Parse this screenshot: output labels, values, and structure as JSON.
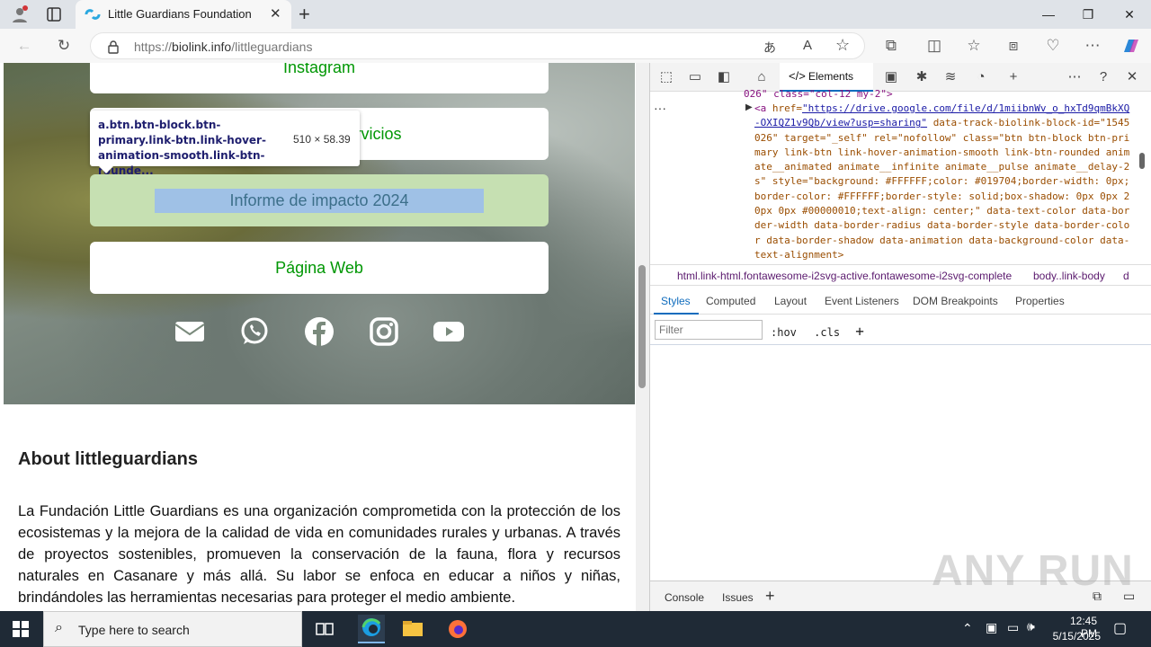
{
  "browser": {
    "tab_title": "Little Guardians Foundation",
    "url_prefix": "https://",
    "url_host": "biolink.info",
    "url_path": "/littleguardians"
  },
  "page": {
    "links": [
      {
        "label": "Instagram"
      },
      {
        "label": "Servicios"
      },
      {
        "label": "Informe de impacto 2024"
      },
      {
        "label": "Página Web"
      }
    ],
    "social_icons": [
      "envelope-icon",
      "whatsapp-icon",
      "facebook-icon",
      "instagram-icon",
      "youtube-icon"
    ],
    "tooltip": {
      "selector": "a.btn.btn-block.btn-primary.link-btn.link-hover-animation-smooth.link-btn-rounde...",
      "dimensions": "510 × 58.39"
    },
    "about_heading": "About littleguardians",
    "about_text": "La Fundación Little Guardians es una organización comprometida con la protección de los ecosistemas y la mejora de la calidad de vida en comunidades rurales y urbanas. A través de proyectos sostenibles, promueven la conservación de la fauna, flora y recursos naturales en Casanare y más allá. Su labor se enfoca en educar a niños y niñas, brindándoles las herramientas necesarias para proteger el medio ambiente.",
    "link_color": "#019704"
  },
  "devtools": {
    "active_tab": "Elements",
    "code_head": "026\" class=\"col-12 my-2\">",
    "code_body_tag": "<a",
    "code_href_attr": "href=",
    "code_href": "\"https://drive.google.com/file/d/1miibnWv_o_hxTd9qmBkXQ-OXIQZ1v9Qb/view?usp=sharing\"",
    "code_rest": "data-track-biolink-block-id=\"1545026\" target=\"_self\" rel=\"nofollow\" class=\"btn btn-block btn-primary link-btn link-hover-animation-smooth link-btn-rounded  animate__animated animate__infinite animate__pulse animate__delay-2s\" style=\"background: #FFFFFF;color: #019704;border-width: 0px;border-color: #FFFFFF;border-style: solid;box-shadow: 0px 0px 20px 0px #00000010;text-align: center;\" data-text-color data-border-width data-border-radius data-border-style data-border-color data-border-shadow data-animation data-background-color data-text-alignment>",
    "breadcrumbs": [
      "html.link-html.fontawesome-i2svg-active.fontawesome-i2svg-complete",
      "body..link-body",
      "d"
    ],
    "panel_tabs": [
      "Styles",
      "Computed",
      "Layout",
      "Event Listeners",
      "DOM Breakpoints",
      "Properties"
    ],
    "filter_placeholder": "Filter",
    "hov": ":hov",
    "cls": ".cls",
    "drawer_tabs": [
      "Console",
      "Issues"
    ]
  },
  "taskbar": {
    "search_placeholder": "Type here to search",
    "time": "12:45 PM",
    "date": "5/15/2025"
  },
  "watermark": "ANY RUN"
}
